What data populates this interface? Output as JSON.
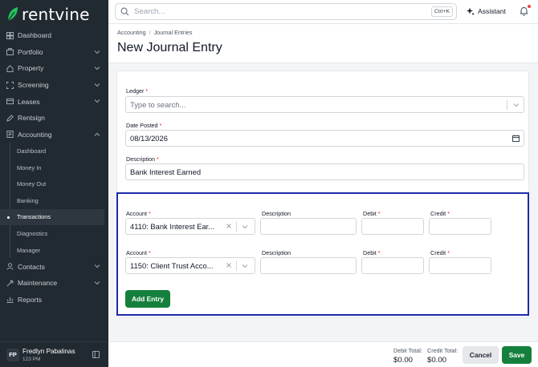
{
  "app": {
    "brand": "rentvine",
    "brand_color": "#22c55e"
  },
  "sidebar": {
    "items": [
      {
        "label": "Dashboard",
        "icon": "dashboard-icon"
      },
      {
        "label": "Portfolio",
        "icon": "portfolio-icon",
        "chevron": "down"
      },
      {
        "label": "Property",
        "icon": "property-icon",
        "chevron": "down"
      },
      {
        "label": "Screening",
        "icon": "screening-icon",
        "chevron": "down"
      },
      {
        "label": "Leases",
        "icon": "leases-icon",
        "chevron": "down"
      },
      {
        "label": "Rentsign",
        "icon": "rentsign-icon"
      },
      {
        "label": "Accounting",
        "icon": "accounting-icon",
        "chevron": "up"
      }
    ],
    "accounting_sub": [
      {
        "label": "Dashboard"
      },
      {
        "label": "Money In"
      },
      {
        "label": "Money Out"
      },
      {
        "label": "Banking"
      },
      {
        "label": "Transactions",
        "active": true
      },
      {
        "label": "Diagnostics"
      },
      {
        "label": "Manager"
      }
    ],
    "items_after": [
      {
        "label": "Contacts",
        "icon": "contacts-icon",
        "chevron": "down"
      },
      {
        "label": "Maintenance",
        "icon": "maintenance-icon",
        "chevron": "down"
      },
      {
        "label": "Reports",
        "icon": "reports-icon"
      }
    ],
    "user": {
      "initials": "FP",
      "name": "Fredlyn Pabalinas",
      "sub": "123 PM"
    }
  },
  "topbar": {
    "search_placeholder": "Search...",
    "shortcut": "Ctrl+K",
    "assistant_label": "Assistant"
  },
  "breadcrumb": {
    "root": "Accounting",
    "separator": "/",
    "current": "Journal Entries"
  },
  "page_title": "New Journal Entry",
  "form": {
    "ledger": {
      "label": "Ledger",
      "placeholder": "Type to search..."
    },
    "date_posted": {
      "label": "Date Posted",
      "value": "08/13/2026"
    },
    "description": {
      "label": "Description",
      "value": "Bank Interest Earned"
    }
  },
  "entries": {
    "labels": {
      "account": "Account",
      "description": "Description",
      "debit": "Debit",
      "credit": "Credit"
    },
    "rows": [
      {
        "account": "4110: Bank Interest Ear...",
        "description": "",
        "debit": "",
        "credit": ""
      },
      {
        "account": "1150: Client Trust Acco...",
        "description": "",
        "debit": "",
        "credit": ""
      }
    ],
    "add_label": "Add Entry"
  },
  "footer": {
    "debit_total_label": "Debit Total:",
    "debit_total": "$0.00",
    "credit_total_label": "Credit Total:",
    "credit_total": "$0.00",
    "cancel_label": "Cancel",
    "save_label": "Save"
  }
}
